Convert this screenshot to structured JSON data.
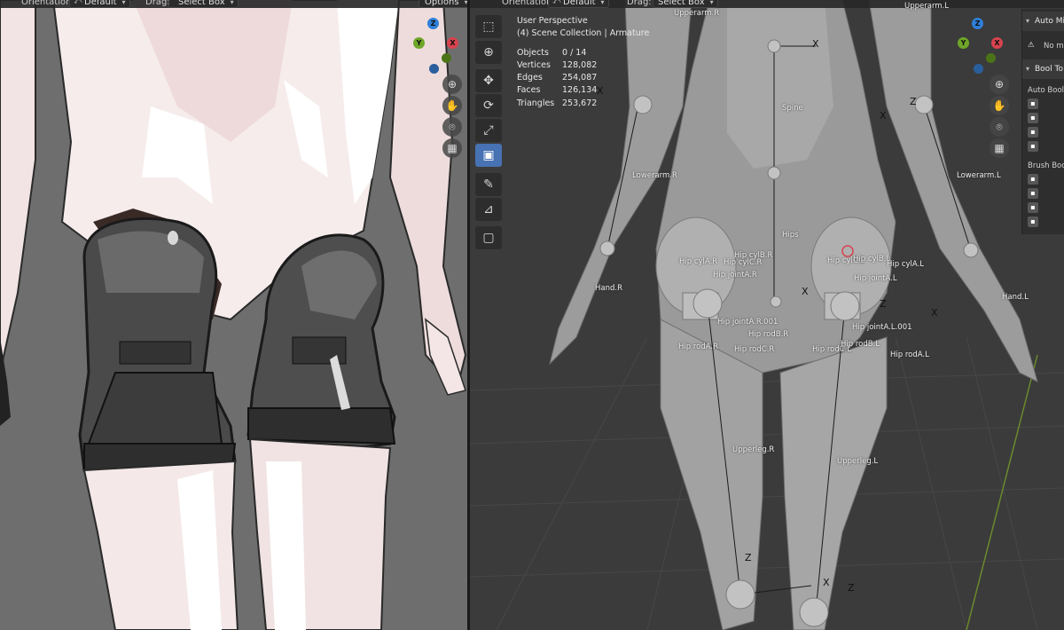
{
  "left_viewport": {
    "header": {
      "orientation_label": "Orientation:",
      "orientation_value": "Default",
      "drag_label": "Drag:",
      "drag_value": "Select Box",
      "options_label": "Options"
    },
    "nav_icons": [
      "zoom-icon",
      "hand-icon",
      "camera-icon",
      "grid-icon"
    ]
  },
  "right_viewport": {
    "header": {
      "orientation_label": "Orientation:",
      "orientation_value": "Default",
      "drag_label": "Drag:",
      "drag_value": "Select Box"
    },
    "overlay": {
      "view_name": "User Perspective",
      "collection": "(4) Scene Collection | Armature",
      "stats": [
        {
          "key": "Objects",
          "value": "0 / 14"
        },
        {
          "key": "Vertices",
          "value": "128,082"
        },
        {
          "key": "Edges",
          "value": "254,087"
        },
        {
          "key": "Faces",
          "value": "126,134"
        },
        {
          "key": "Triangles",
          "value": "253,672"
        }
      ]
    },
    "tools": [
      "select-box-icon",
      "cursor-icon",
      "move-icon",
      "rotate-icon",
      "scale-icon",
      "transform-icon",
      "annotate-icon",
      "measure-icon",
      "add-cube-icon"
    ],
    "bones": {
      "upperarm_r": "Upperarm.R",
      "upperarm_l": "Upperarm.L",
      "spine": "Spine",
      "lowerarm_r": "Lowerarm.R",
      "lowerarm_l": "Lowerarm.L",
      "hips": "Hips",
      "hip_cylb_r": "Hip cylB.R",
      "hip_cyla_r": "Hip cylA.R",
      "hip_cylc_r": "Hip cylC.R",
      "hip_jointa_r": "Hip jointA.R",
      "hip_cylc_l": "Hip cylC.L",
      "hip_cylb_l": "Hip cylB.L",
      "hip_cyla_l": "Hip cylA.L",
      "hip_jointa_l": "Hip jointA.L",
      "hand_r": "Hand.R",
      "hand_l": "Hand.L",
      "hip_jointa_r_001": "Hip jointA.R.001",
      "hip_jointa_l_001": "Hip jointA.L.001",
      "hip_rodb_r": "Hip rodB.R",
      "hip_roda_r": "Hip rodA.R",
      "hip_rodc_r": "Hip rodC.R",
      "hip_rodc_l": "Hip rodC.L",
      "hip_rodb_l": "Hip rodB.L",
      "hip_roda_l": "Hip rodA.L",
      "upperleg_r": "Upperleg.R",
      "upperleg_l": "Upperleg.L"
    },
    "axis_marks": {
      "x": "X",
      "z": "Z"
    }
  },
  "n_panel": {
    "auto_mirror": "Auto Mi",
    "warning_text": "No m",
    "bool_tool": "Bool To",
    "auto_boolean": "Auto Boole",
    "brush_boolean": "Brush Boo"
  },
  "gizmo": {
    "x": "X",
    "y": "Y",
    "z": "Z"
  },
  "colors": {
    "left_bg": "#6e6e6e",
    "right_bg": "#3b3b3b",
    "accent": "#4772b3",
    "axis_x": "#d8434f",
    "axis_y": "#6fa628",
    "axis_z": "#2f7fd8"
  }
}
